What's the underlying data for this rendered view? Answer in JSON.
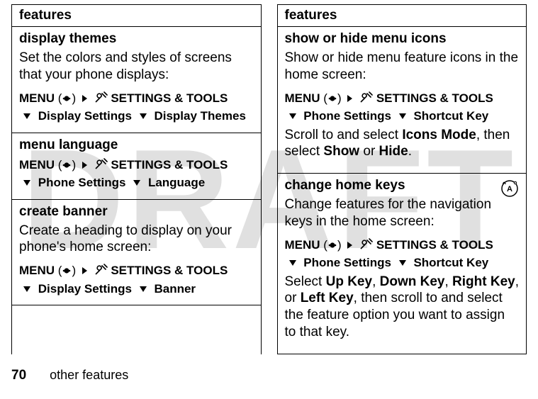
{
  "watermark": "DRAFT",
  "left": {
    "header": "features",
    "sections": [
      {
        "title": "display themes",
        "body": "Set the colors and styles of screens that your phone displays:",
        "menu_label": "MENU",
        "path_tool": "SETTINGS & TOOLS",
        "path_items": [
          "Display Settings",
          "Display Themes"
        ]
      },
      {
        "title": "menu language",
        "menu_label": "MENU",
        "path_tool": "SETTINGS & TOOLS",
        "path_items": [
          "Phone Settings",
          "Language"
        ]
      },
      {
        "title": "create banner",
        "body": "Create a heading to display on your phone's home screen:",
        "menu_label": "MENU",
        "path_tool": "SETTINGS & TOOLS",
        "path_items": [
          "Display Settings",
          "Banner"
        ]
      }
    ]
  },
  "right": {
    "header": "features",
    "sections": [
      {
        "title": "show or hide menu icons",
        "body": "Show or hide menu feature icons in the home screen:",
        "menu_label": "MENU",
        "path_tool": "SETTINGS & TOOLS",
        "path_items": [
          "Phone Settings",
          "Shortcut Key"
        ],
        "after_pre": "Scroll to and select ",
        "after_b1": "Icons Mode",
        "after_mid": ", then select ",
        "after_b2": "Show",
        "after_or": " or ",
        "after_b3": "Hide",
        "after_end": "."
      },
      {
        "title": "change home keys",
        "body": "Change features for the navigation keys in the home screen:",
        "menu_label": "MENU",
        "path_tool": "SETTINGS & TOOLS",
        "path_items": [
          "Phone Settings",
          "Shortcut Key"
        ],
        "after2_pre": "Select ",
        "after2_b1": "Up Key",
        "after2_s1": ", ",
        "after2_b2": "Down Key",
        "after2_s2": ", ",
        "after2_b3": "Right Key",
        "after2_s3": ", or ",
        "after2_b4": "Left Key",
        "after2_end": ", then scroll to and select the feature option you want to assign to that key.",
        "has_ext_icon": true
      }
    ]
  },
  "footer": {
    "page": "70",
    "label": "other features"
  }
}
